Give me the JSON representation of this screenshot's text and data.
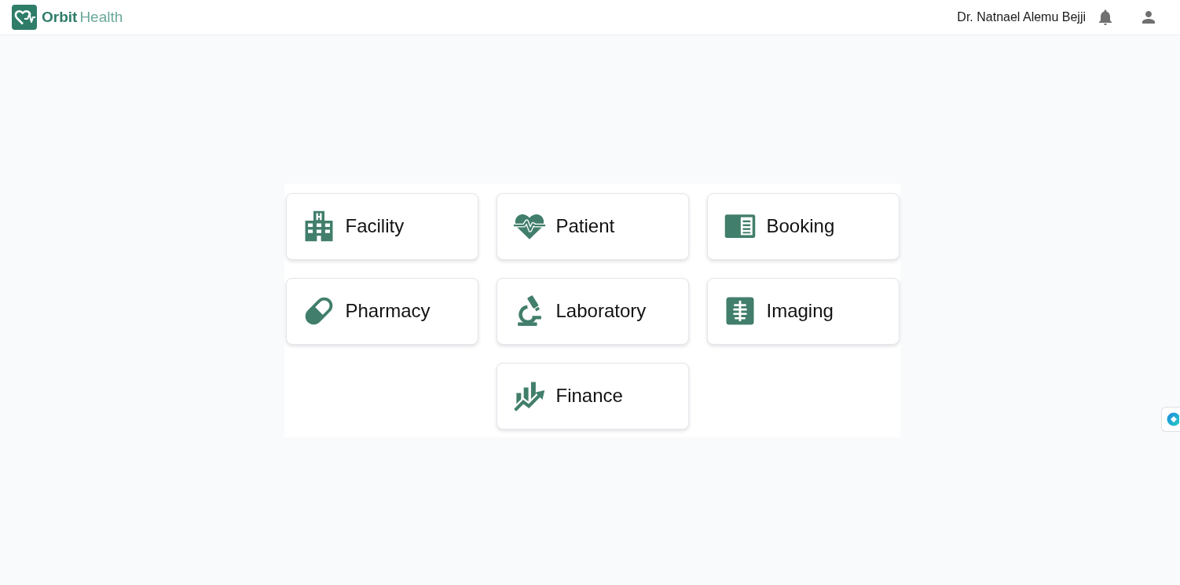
{
  "header": {
    "brand": {
      "name": "Orbit",
      "suffix": "Health"
    },
    "user_name": "Dr. Natnael Alemu Bejji"
  },
  "modules": [
    {
      "label": "Facility",
      "kind": "facility"
    },
    {
      "label": "Patient",
      "kind": "patient"
    },
    {
      "label": "Booking",
      "kind": "booking"
    },
    {
      "label": "Pharmacy",
      "kind": "pharmacy"
    },
    {
      "label": "Laboratory",
      "kind": "laboratory"
    },
    {
      "label": "Imaging",
      "kind": "imaging"
    },
    {
      "label": "Finance",
      "kind": "finance"
    }
  ]
}
